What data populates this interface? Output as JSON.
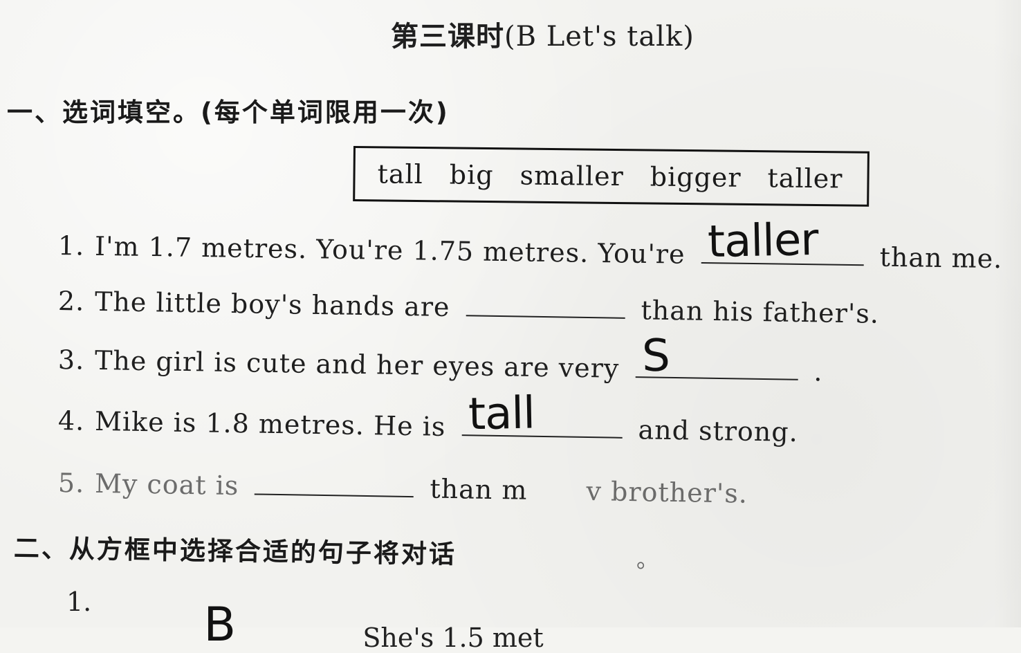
{
  "title": {
    "cjk": "第三课时",
    "latin": "(B Let's talk)"
  },
  "section1": {
    "heading": "一、选词填空。(每个单词限用一次)"
  },
  "word_box": {
    "words": [
      "tall",
      "big",
      "smaller",
      "bigger",
      "taller"
    ]
  },
  "questions": [
    {
      "number": "1.",
      "prefix": "I'm 1.7 metres. You're 1.75 metres. You're",
      "answer": "taller",
      "suffix": "than me."
    },
    {
      "number": "2.",
      "prefix": "The little boy's hands are",
      "answer": "",
      "suffix": "than his father's."
    },
    {
      "number": "3.",
      "prefix": "The girl is cute and her eyes are very",
      "answer": "S",
      "suffix": "."
    },
    {
      "number": "4.",
      "prefix": "Mike is 1.8 metres. He is",
      "answer": "tall",
      "suffix": "and strong."
    },
    {
      "number": "5.",
      "prefix": "My coat is",
      "answer": "",
      "suffix_left": "than m",
      "suffix_right": "v brother's."
    }
  ],
  "section2": {
    "heading": "二、从方框中选择合适的句子将对话",
    "trailing_mark": "。"
  },
  "footer": {
    "number": "1.",
    "answer": "B",
    "text": "She's 1.5 met"
  }
}
